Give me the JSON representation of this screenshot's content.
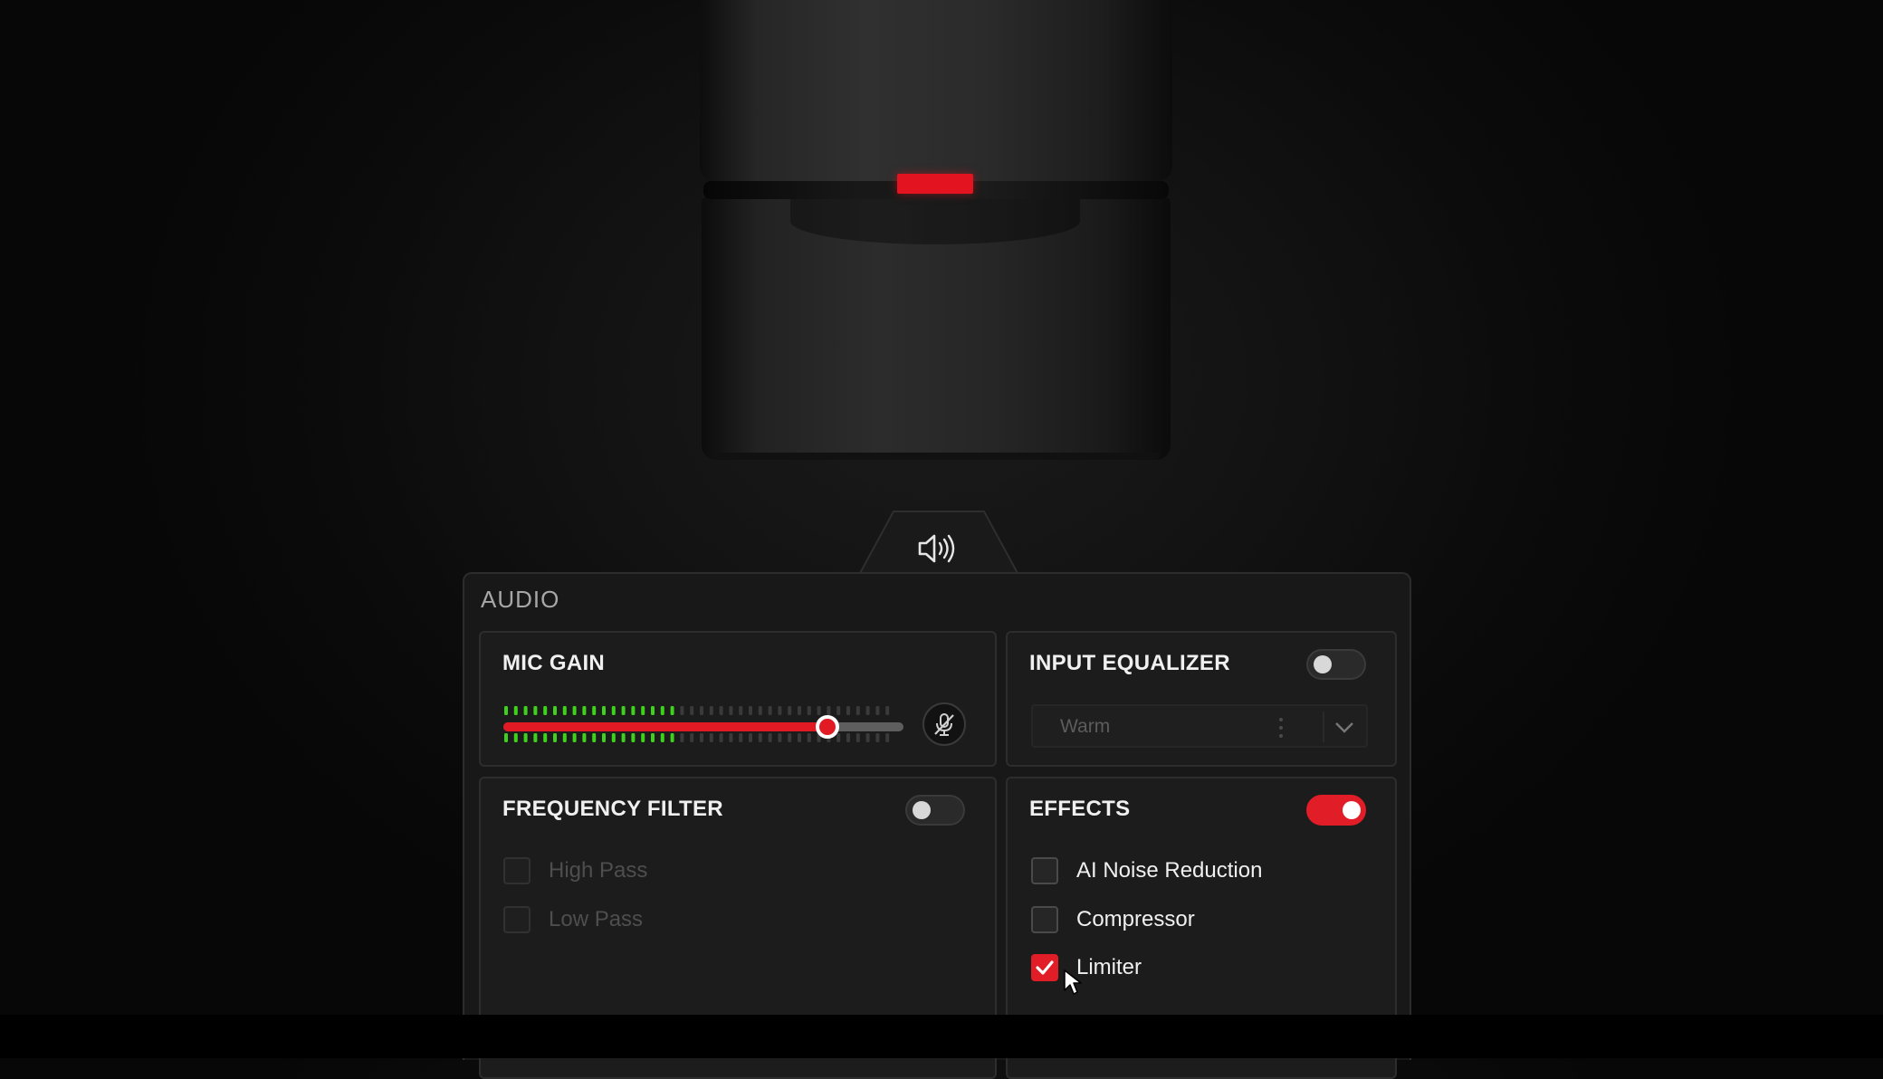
{
  "panel": {
    "title": "AUDIO",
    "tab_icon": "speaker-icon"
  },
  "mic_gain": {
    "title": "MIC GAIN",
    "level_fraction": 0.81,
    "meter_active_fraction": 0.46,
    "mute_icon": "mic-muted-icon",
    "colors": {
      "fill": "#e21a24",
      "meter_active": "#3fd21c",
      "meter_idle": "#3a3a3a"
    }
  },
  "input_equalizer": {
    "title": "INPUT EQUALIZER",
    "enabled": false,
    "preset": "Warm"
  },
  "frequency_filter": {
    "title": "FREQUENCY FILTER",
    "enabled": false,
    "options": [
      {
        "label": "High Pass",
        "checked": false
      },
      {
        "label": "Low Pass",
        "checked": false
      }
    ]
  },
  "effects": {
    "title": "EFFECTS",
    "enabled": true,
    "options": [
      {
        "label": "AI Noise Reduction",
        "checked": false
      },
      {
        "label": "Compressor",
        "checked": false
      },
      {
        "label": "Limiter",
        "checked": true
      }
    ]
  },
  "accent_color": "#e11d27"
}
